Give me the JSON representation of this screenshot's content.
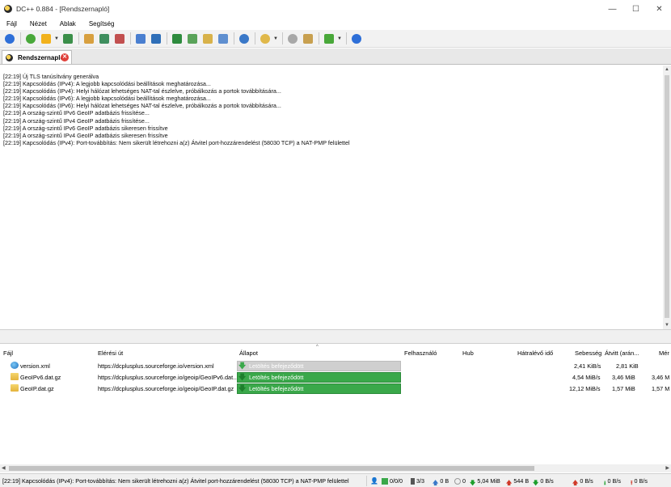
{
  "window": {
    "title": "DC++ 0.884 - [Rendszernapló]",
    "minimize": "—",
    "maximize": "☐",
    "close": "✕"
  },
  "menu": [
    "Fájl",
    "Nézet",
    "Ablak",
    "Segítség"
  ],
  "toolbar": {
    "icons": [
      {
        "name": "back-icon",
        "color": "#2e6fd8"
      },
      {
        "name": "reconnect-icon",
        "color": "#49a83a"
      },
      {
        "name": "favorites-icon",
        "color": "#f2b21c"
      },
      {
        "name": "download-queue-icon",
        "color": "#3b8f4a"
      },
      {
        "name": "finished-downloads-icon",
        "color": "#d8a040"
      },
      {
        "name": "users-icon",
        "color": "#3f8f5f"
      },
      {
        "name": "upload-queue-icon",
        "color": "#c25050"
      },
      {
        "name": "search-icon",
        "color": "#4a7fd0"
      },
      {
        "name": "adl-search-icon",
        "color": "#2f6fb8"
      },
      {
        "name": "search-spy-icon",
        "color": "#2e8b3e"
      },
      {
        "name": "open-filelist-icon",
        "color": "#5aa35a"
      },
      {
        "name": "notepad-icon",
        "color": "#d8b24a"
      },
      {
        "name": "network-stats-icon",
        "color": "#5f8fd0"
      },
      {
        "name": "refresh-icon",
        "color": "#3a78c8"
      },
      {
        "name": "away-icon",
        "color": "#e0b84a"
      },
      {
        "name": "settings-icon",
        "color": "#a8a8a8"
      },
      {
        "name": "edit-icon",
        "color": "#c8a050"
      },
      {
        "name": "plugins-icon",
        "color": "#49a83a"
      },
      {
        "name": "help-icon",
        "color": "#2e6fd8"
      }
    ]
  },
  "tab": {
    "label": "Rendszernapló"
  },
  "log": [
    "[22:19] Új TLS tanúsítvány generálva",
    "[22:19] Kapcsolódás (IPv4): A legjobb kapcsolódási beállítások meghatározása...",
    "[22:19] Kapcsolódás (IPv4): Helyi hálózat lehetséges NAT-tal észlelve, próbálkozás a portok továbbítására...",
    "[22:19] Kapcsolódás (IPv6): A legjobb kapcsolódási beállítások meghatározása...",
    "[22:19] Kapcsolódás (IPv6): Helyi hálózat lehetséges NAT-tal észlelve, próbálkozás a portok továbbítására...",
    "[22:19] A ország-szintű IPv6 GeoIP adatbázis frissítése...",
    "[22:19] A ország-szintű IPv4 GeoIP adatbázis frissítése...",
    "[22:19] A ország-szintű IPv6 GeoIP adatbázis sikeresen frissítve",
    "[22:19] A ország-szintű IPv4 GeoIP adatbázis sikeresen frissítve",
    "[22:19] Kapcsolódás (IPv4): Port-továbbítás: Nem sikerült létrehozni a(z) Átvitel port-hozzárendelést (58030 TCP) a NAT-PMP felülettel"
  ],
  "transfers": {
    "columns": {
      "file": "Fájl",
      "path": "Elérési út",
      "status": "Állapot",
      "user": "Felhasználó",
      "hub": "Hub",
      "time_left": "Hátralévő idő",
      "speed": "Sebesség",
      "transferred": "Átvitt (arán...",
      "size": "Mér"
    },
    "rows": [
      {
        "file": "version.xml",
        "path": "https://dcplusplus.sourceforge.io/version.xml",
        "status": "Letöltés befejeződött",
        "speed": "2,41 KiB/s",
        "transferred": "2,81 KiB",
        "size": ""
      },
      {
        "file": "GeoIPv6.dat.gz",
        "path": "https://dcplusplus.sourceforge.io/geoip/GeoIPv6.dat...",
        "status": "Letöltés befejeződött",
        "speed": "4,54 MiB/s",
        "transferred": "3,46 MiB",
        "size": "3,46 M"
      },
      {
        "file": "GeoIP.dat.gz",
        "path": "https://dcplusplus.sourceforge.io/geoip/GeoIP.dat.gz",
        "status": "Letöltés befejeződött",
        "speed": "12,12 MiB/s",
        "transferred": "1,57 MiB",
        "size": "1,57 M"
      }
    ]
  },
  "statusbar": {
    "message": "[22:19] Kapcsolódás (IPv4): Port-továbbítás: Nem sikerült létrehozni a(z) Átvitel port-hozzárendelést (58030 TCP) a NAT-PMP felülettel",
    "hubs": "0/0/0",
    "slots": "3/3",
    "upload_total": "0 B",
    "queue": "0",
    "download_total": "5,04 MiB",
    "upload_amount": "544 B",
    "download_speed": "0 B/s",
    "upload_speed": "0 B/s",
    "down_limit": "0 B/s",
    "up_limit": "0 B/s"
  },
  "colors": {
    "progress_green": "#3aa84a",
    "progress_grey": "#cfcfcf",
    "tab_close": "#e0403a"
  }
}
